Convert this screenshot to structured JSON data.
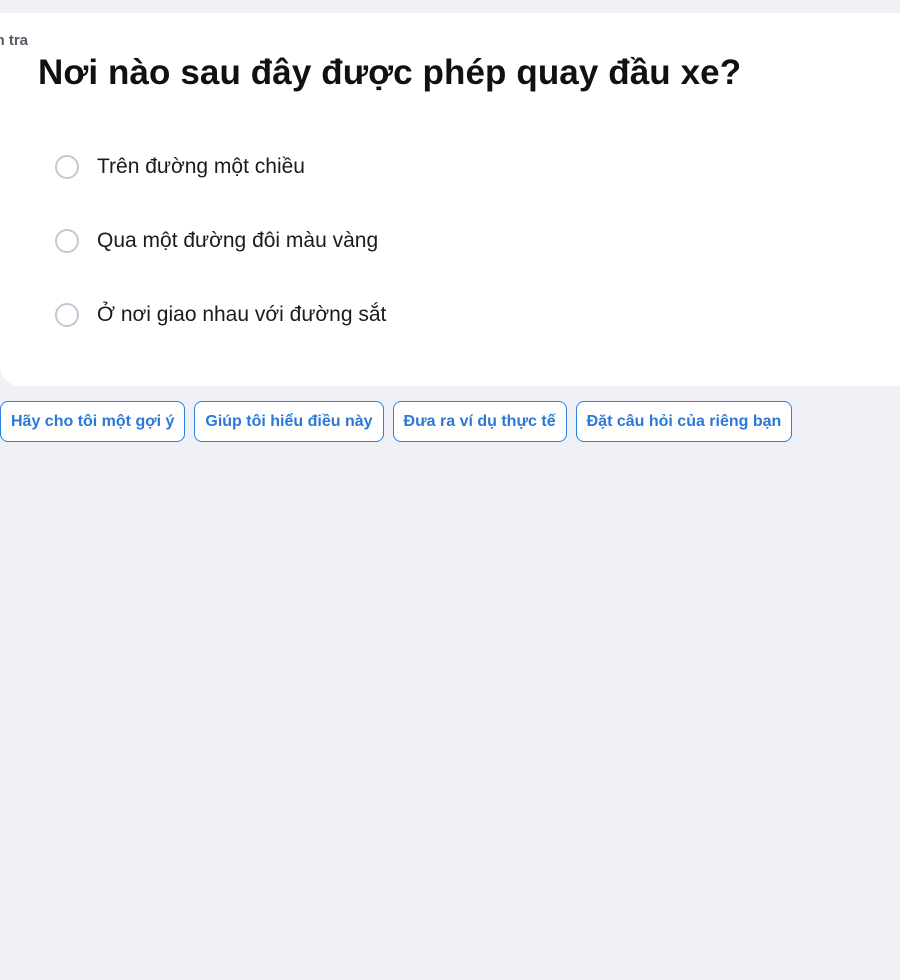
{
  "quiz": {
    "kind_label": "Kiểm tra",
    "question": "Nơi nào sau đây được phép quay đầu xe?",
    "options": [
      {
        "label": "Trên đường một chiều",
        "selected": false
      },
      {
        "label": "Qua một đường đôi màu vàng",
        "selected": false
      },
      {
        "label": "Ở nơi giao nhau với đường sắt",
        "selected": false
      }
    ]
  },
  "actions": {
    "hint": "Hãy cho tôi một gợi ý",
    "explain": "Giúp tôi hiểu điều này",
    "example": "Đưa ra ví dụ thực tế",
    "ask": "Đặt câu hỏi của riêng bạn"
  },
  "colors": {
    "page_background": "#f0f1f6",
    "card_background": "#ffffff",
    "accent": "#2b78d6",
    "radio_border": "#c5c7d2"
  }
}
